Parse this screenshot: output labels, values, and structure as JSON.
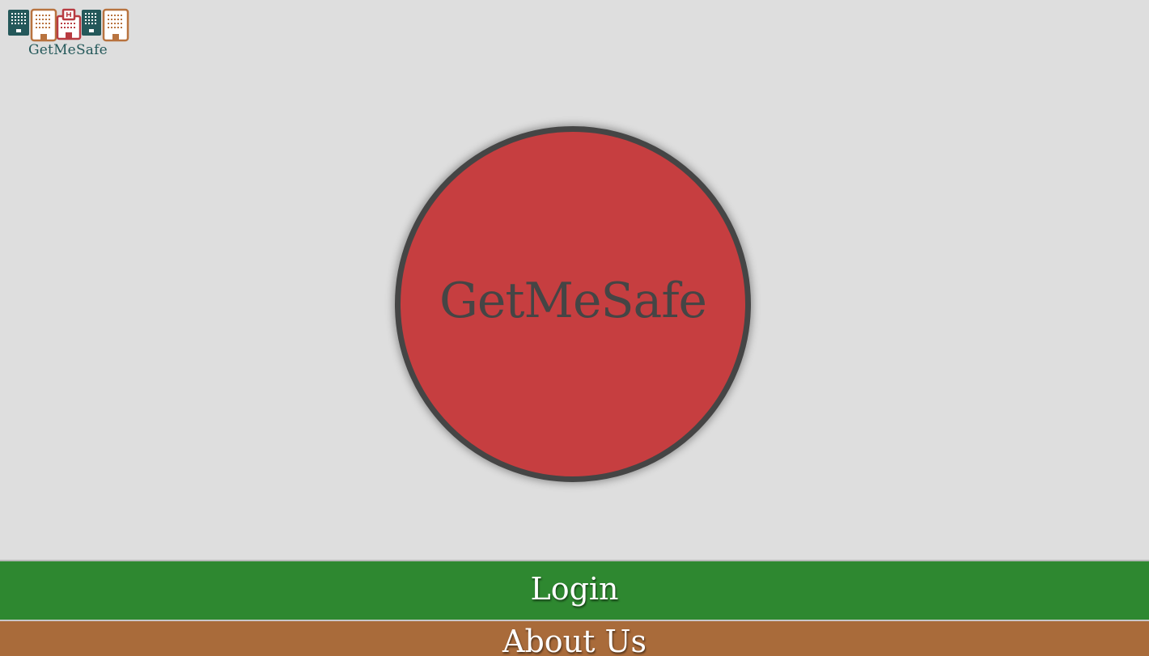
{
  "logo": {
    "text": "GetMeSafe",
    "colors": {
      "teal": "#24585a",
      "orange": "#b8733f",
      "red": "#b83b41"
    }
  },
  "panic_button": {
    "label": "GetMeSafe",
    "fill_color": "#c63e40",
    "border_color": "#454545"
  },
  "nav": {
    "login_label": "Login",
    "login_color": "#2e8830",
    "about_label": "About Us",
    "about_color": "#a96b3a"
  },
  "background_color": "#dedede"
}
